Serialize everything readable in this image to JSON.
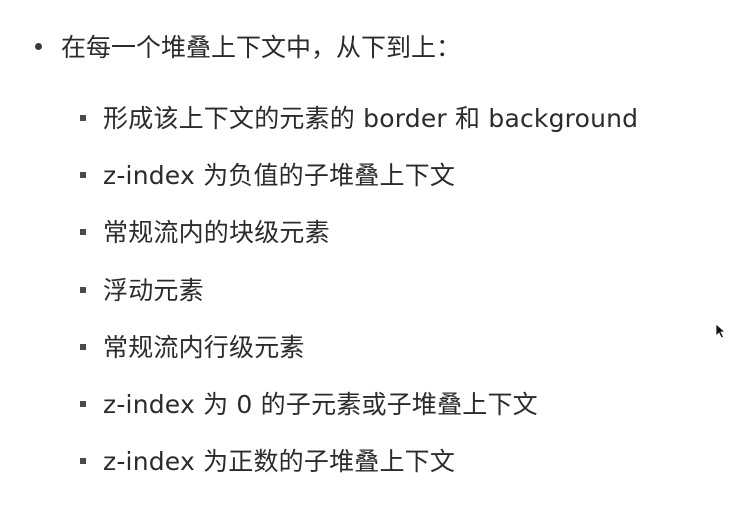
{
  "top_item": {
    "text": "在每一个堆叠上下文中，从下到上："
  },
  "sub_items": [
    {
      "text": "形成该上下文的元素的 border 和 background"
    },
    {
      "text": "z-index 为负值的子堆叠上下文"
    },
    {
      "text": "常规流内的块级元素"
    },
    {
      "text": "浮动元素"
    },
    {
      "text": "常规流内行级元素"
    },
    {
      "text": "z-index 为 0 的子元素或子堆叠上下文"
    },
    {
      "text": "z-index 为正数的子堆叠上下文"
    }
  ],
  "colors": {
    "text": "#2b2b2b",
    "bullet": "#3a3a3a",
    "background": "#ffffff"
  },
  "icons": {
    "cursor": "mouse-pointer-icon"
  }
}
